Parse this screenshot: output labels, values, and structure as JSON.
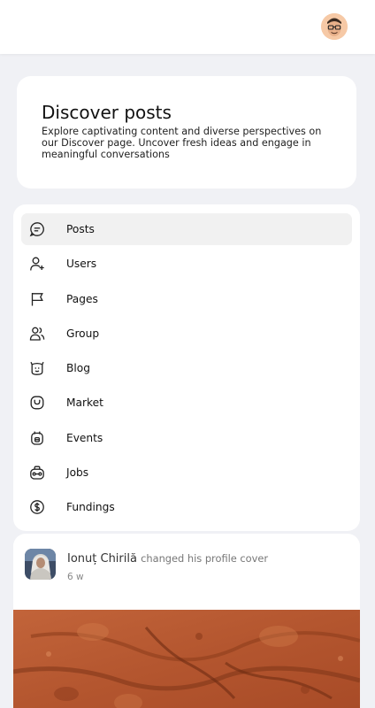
{
  "header": {
    "avatar_icon": "user-avatar-glasses-icon"
  },
  "hero": {
    "title": "Discover posts",
    "description": "Explore captivating content and diverse perspectives on our Discover page. Uncover fresh ideas and engage in meaningful conversations"
  },
  "nav": {
    "active_index": 0,
    "items": [
      {
        "label": "Posts",
        "icon": "chat-bubble-icon"
      },
      {
        "label": "Users",
        "icon": "user-plus-icon"
      },
      {
        "label": "Pages",
        "icon": "flag-icon"
      },
      {
        "label": "Group",
        "icon": "users-group-icon"
      },
      {
        "label": "Blog",
        "icon": "blog-face-icon"
      },
      {
        "label": "Market",
        "icon": "shopping-bag-icon"
      },
      {
        "label": "Events",
        "icon": "calendar-icon"
      },
      {
        "label": "Jobs",
        "icon": "briefcase-icon"
      },
      {
        "label": "Fundings",
        "icon": "dollar-coin-icon"
      }
    ]
  },
  "post": {
    "author": "Ionuț Chirilă",
    "action": "changed his profile cover",
    "time": "6 w",
    "image_icon": "mars-surface-cover-image"
  },
  "colors": {
    "background": "#f0f1f5",
    "card": "#ffffff",
    "active_item": "#f1f1f1",
    "avatar_bg": "#f6c9a6",
    "cover_terrain": "#b4562f"
  }
}
